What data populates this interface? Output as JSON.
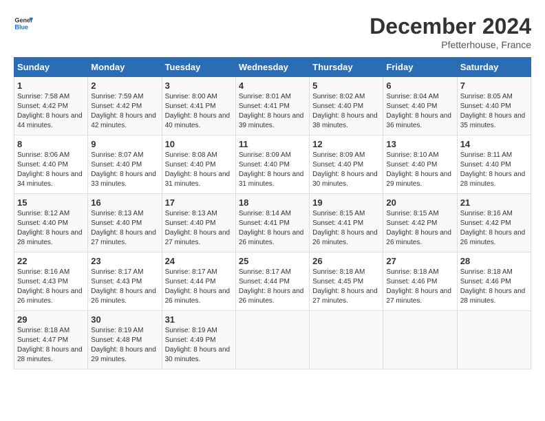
{
  "header": {
    "logo_line1": "General",
    "logo_line2": "Blue",
    "month": "December 2024",
    "location": "Pfetterhouse, France"
  },
  "days_of_week": [
    "Sunday",
    "Monday",
    "Tuesday",
    "Wednesday",
    "Thursday",
    "Friday",
    "Saturday"
  ],
  "weeks": [
    [
      {
        "day": "1",
        "sunrise": "7:58 AM",
        "sunset": "4:42 PM",
        "daylight": "8 hours and 44 minutes."
      },
      {
        "day": "2",
        "sunrise": "7:59 AM",
        "sunset": "4:42 PM",
        "daylight": "8 hours and 42 minutes."
      },
      {
        "day": "3",
        "sunrise": "8:00 AM",
        "sunset": "4:41 PM",
        "daylight": "8 hours and 40 minutes."
      },
      {
        "day": "4",
        "sunrise": "8:01 AM",
        "sunset": "4:41 PM",
        "daylight": "8 hours and 39 minutes."
      },
      {
        "day": "5",
        "sunrise": "8:02 AM",
        "sunset": "4:40 PM",
        "daylight": "8 hours and 38 minutes."
      },
      {
        "day": "6",
        "sunrise": "8:04 AM",
        "sunset": "4:40 PM",
        "daylight": "8 hours and 36 minutes."
      },
      {
        "day": "7",
        "sunrise": "8:05 AM",
        "sunset": "4:40 PM",
        "daylight": "8 hours and 35 minutes."
      }
    ],
    [
      {
        "day": "8",
        "sunrise": "8:06 AM",
        "sunset": "4:40 PM",
        "daylight": "8 hours and 34 minutes."
      },
      {
        "day": "9",
        "sunrise": "8:07 AM",
        "sunset": "4:40 PM",
        "daylight": "8 hours and 33 minutes."
      },
      {
        "day": "10",
        "sunrise": "8:08 AM",
        "sunset": "4:40 PM",
        "daylight": "8 hours and 31 minutes."
      },
      {
        "day": "11",
        "sunrise": "8:09 AM",
        "sunset": "4:40 PM",
        "daylight": "8 hours and 31 minutes."
      },
      {
        "day": "12",
        "sunrise": "8:09 AM",
        "sunset": "4:40 PM",
        "daylight": "8 hours and 30 minutes."
      },
      {
        "day": "13",
        "sunrise": "8:10 AM",
        "sunset": "4:40 PM",
        "daylight": "8 hours and 29 minutes."
      },
      {
        "day": "14",
        "sunrise": "8:11 AM",
        "sunset": "4:40 PM",
        "daylight": "8 hours and 28 minutes."
      }
    ],
    [
      {
        "day": "15",
        "sunrise": "8:12 AM",
        "sunset": "4:40 PM",
        "daylight": "8 hours and 28 minutes."
      },
      {
        "day": "16",
        "sunrise": "8:13 AM",
        "sunset": "4:40 PM",
        "daylight": "8 hours and 27 minutes."
      },
      {
        "day": "17",
        "sunrise": "8:13 AM",
        "sunset": "4:40 PM",
        "daylight": "8 hours and 27 minutes."
      },
      {
        "day": "18",
        "sunrise": "8:14 AM",
        "sunset": "4:41 PM",
        "daylight": "8 hours and 26 minutes."
      },
      {
        "day": "19",
        "sunrise": "8:15 AM",
        "sunset": "4:41 PM",
        "daylight": "8 hours and 26 minutes."
      },
      {
        "day": "20",
        "sunrise": "8:15 AM",
        "sunset": "4:42 PM",
        "daylight": "8 hours and 26 minutes."
      },
      {
        "day": "21",
        "sunrise": "8:16 AM",
        "sunset": "4:42 PM",
        "daylight": "8 hours and 26 minutes."
      }
    ],
    [
      {
        "day": "22",
        "sunrise": "8:16 AM",
        "sunset": "4:43 PM",
        "daylight": "8 hours and 26 minutes."
      },
      {
        "day": "23",
        "sunrise": "8:17 AM",
        "sunset": "4:43 PM",
        "daylight": "8 hours and 26 minutes."
      },
      {
        "day": "24",
        "sunrise": "8:17 AM",
        "sunset": "4:44 PM",
        "daylight": "8 hours and 26 minutes."
      },
      {
        "day": "25",
        "sunrise": "8:17 AM",
        "sunset": "4:44 PM",
        "daylight": "8 hours and 26 minutes."
      },
      {
        "day": "26",
        "sunrise": "8:18 AM",
        "sunset": "4:45 PM",
        "daylight": "8 hours and 27 minutes."
      },
      {
        "day": "27",
        "sunrise": "8:18 AM",
        "sunset": "4:46 PM",
        "daylight": "8 hours and 27 minutes."
      },
      {
        "day": "28",
        "sunrise": "8:18 AM",
        "sunset": "4:46 PM",
        "daylight": "8 hours and 28 minutes."
      }
    ],
    [
      {
        "day": "29",
        "sunrise": "8:18 AM",
        "sunset": "4:47 PM",
        "daylight": "8 hours and 28 minutes."
      },
      {
        "day": "30",
        "sunrise": "8:19 AM",
        "sunset": "4:48 PM",
        "daylight": "8 hours and 29 minutes."
      },
      {
        "day": "31",
        "sunrise": "8:19 AM",
        "sunset": "4:49 PM",
        "daylight": "8 hours and 30 minutes."
      },
      {
        "day": "",
        "sunrise": "",
        "sunset": "",
        "daylight": ""
      },
      {
        "day": "",
        "sunrise": "",
        "sunset": "",
        "daylight": ""
      },
      {
        "day": "",
        "sunrise": "",
        "sunset": "",
        "daylight": ""
      },
      {
        "day": "",
        "sunrise": "",
        "sunset": "",
        "daylight": ""
      }
    ]
  ]
}
